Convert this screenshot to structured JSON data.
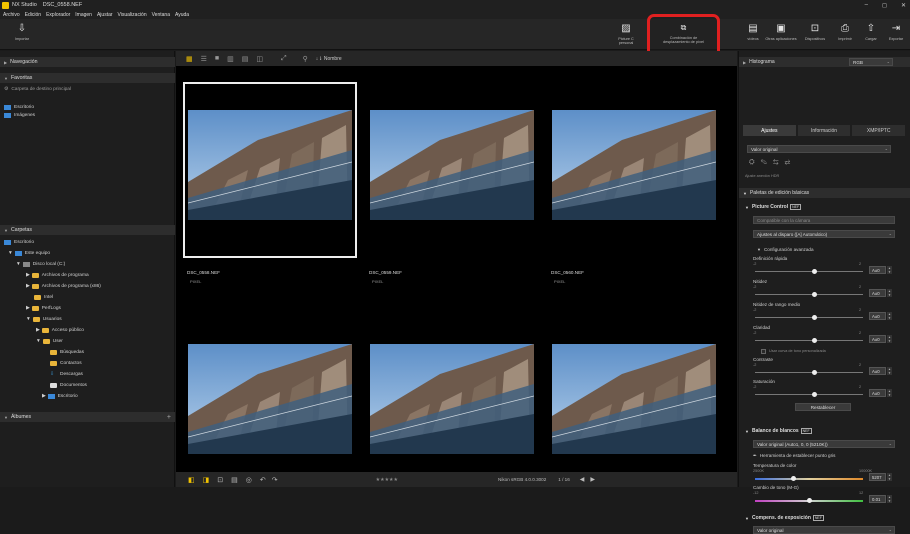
{
  "app": {
    "title": "NX Studio",
    "file": "DSC_0558.NEF"
  },
  "window": {
    "minimize": "–",
    "maximize": "◻",
    "close": "✕"
  },
  "menu": [
    "Archivo",
    "Edición",
    "Explorador",
    "Imagen",
    "Ajustar",
    "Visualización",
    "Ventana",
    "Ayuda"
  ],
  "toolbar": {
    "import": "Importar",
    "picture_control": "Picture C",
    "picture_control_2": "personal",
    "pixel_shift": "Combinación de",
    "pixel_shift_2": "desplazamiento de píxel",
    "other_apps": "Otras aplicaciones",
    "devices": "Dispositivos",
    "print": "Imprimir",
    "upload": "Cargar",
    "export": "Exportar",
    "videos": "vídeos"
  },
  "left": {
    "navigation": "Navegación",
    "favorites": "Favoritas",
    "dest_folder": "Carpeta de destino principal",
    "fav_items": [
      "Escritorio",
      "Imágenes"
    ],
    "folders": "Carpetas",
    "tree": [
      "Escritorio",
      "Este equipo",
      "Disco local (C:)",
      "Archivos de programa",
      "Archivos de programa (x86)",
      "Intel",
      "PerfLogs",
      "Usuarios",
      "Acceso público",
      "User",
      "Búsquedas",
      "Contactos",
      "Descargas",
      "Documentos",
      "Escritorio"
    ],
    "albums": "Álbumes",
    "add": "+"
  },
  "grid": {
    "sort": "Nombre",
    "files": [
      "DSC_0558.NEF",
      "DSC_0559.NEF",
      "DSC_0560.NEF"
    ],
    "pixel_label": "PIXEL"
  },
  "bottom": {
    "color_space": "Nikon sRGB 4.0.0.3002",
    "page": "1 / 16",
    "stars": "★★★★★"
  },
  "right": {
    "histogram": "Histograma",
    "hist_mode": "RGB",
    "tabs": [
      "Ajustes",
      "Información",
      "XMP/IPTC"
    ],
    "preset": "Valor original",
    "hdr": "Ajuste anexión HDR",
    "basic": "Paletas de edición básicas",
    "pc_title": "Picture Control",
    "pc_badge": "NEF",
    "pc_compat": "Compatible con la cámara",
    "pc_value": "Ajustes al disparo ([A] Automático)",
    "advanced": "Configuración avanzada",
    "sliders": [
      {
        "name": "Definición rápida",
        "min": "-2",
        "max": "2",
        "val": "A±0",
        "pos": 0.55
      },
      {
        "name": "Nitidez",
        "min": "-2",
        "max": "2",
        "val": "A±0",
        "pos": 0.55
      },
      {
        "name": "Nitidez de rango medio",
        "min": "-2",
        "max": "2",
        "val": "A±0",
        "pos": 0.55
      },
      {
        "name": "Claridad",
        "min": "-2",
        "max": "2",
        "val": "A±0",
        "pos": 0.55
      }
    ],
    "custom_curve": "Usar curva de tono personalizada",
    "contrast": {
      "name": "Contraste",
      "min": "-2",
      "max": "2",
      "val": "A±0",
      "pos": 0.55
    },
    "saturation": {
      "name": "Saturación",
      "min": "-2",
      "max": "2",
      "val": "A±0",
      "pos": 0.55
    },
    "reset": "Restablecer",
    "wb_title": "Balance de blancos",
    "wb_badge": "NEF",
    "wb_value": "Valor original (Auto1, 0, 0 (5210K))",
    "wb_tool": "Herramienta de establecer punto gris",
    "temp": {
      "name": "Temperatura de color",
      "min": "2500K",
      "max": "10000K",
      "val": "5207",
      "pos": 0.36
    },
    "tint": {
      "name": "Cambio de tono (M-G)",
      "min": "-12",
      "max": "12",
      "val": "0.01",
      "pos": 0.5
    },
    "exp_title": "Compens. de exposición",
    "exp_badge": "NEF",
    "exp_value": "Valor original"
  }
}
